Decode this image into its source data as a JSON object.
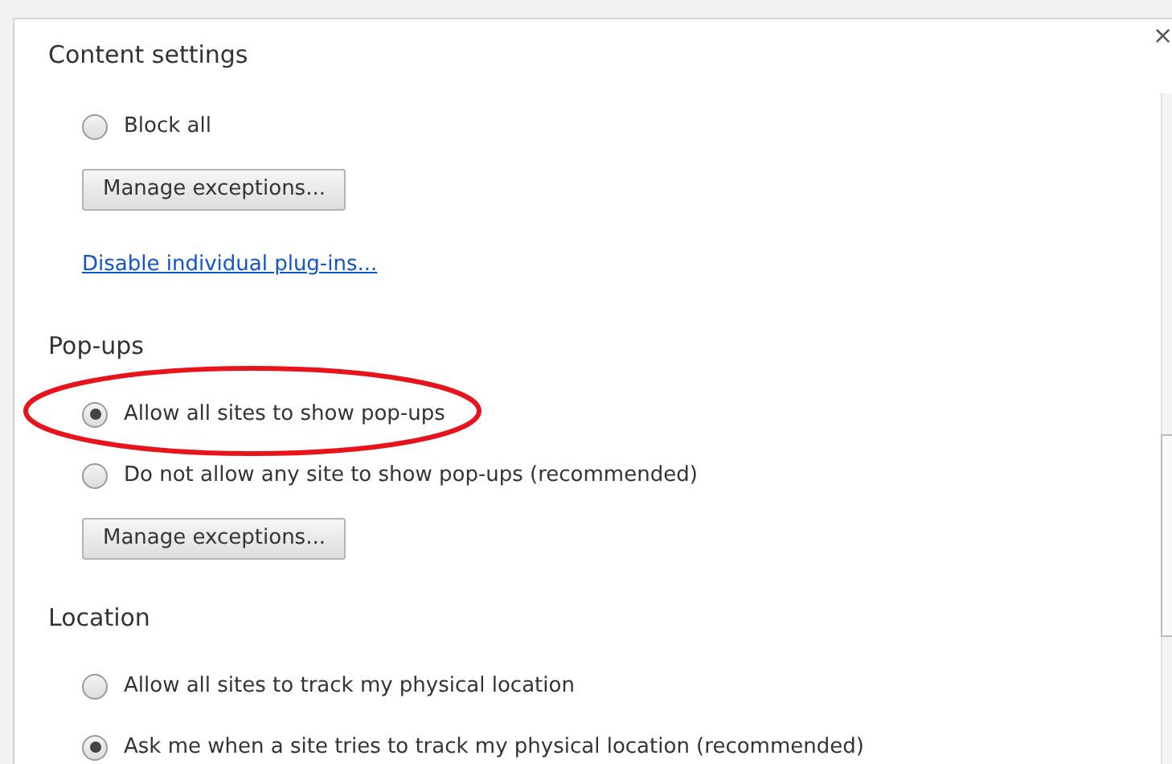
{
  "dialog": {
    "title": "Content settings",
    "close": "×"
  },
  "sections": [
    {
      "items": [
        {
          "kind": "radio",
          "label": "Block all",
          "selected": false
        },
        {
          "kind": "button",
          "label": "Manage exceptions..."
        },
        {
          "kind": "link",
          "label": "Disable individual plug-ins..."
        }
      ]
    },
    {
      "heading": "Pop-ups",
      "items": [
        {
          "kind": "radio",
          "label": "Allow all sites to show pop-ups",
          "selected": true
        },
        {
          "kind": "radio",
          "label": "Do not allow any site to show pop-ups (recommended)",
          "selected": false
        },
        {
          "kind": "button",
          "label": "Manage exceptions..."
        }
      ]
    },
    {
      "heading": "Location",
      "items": [
        {
          "kind": "radio",
          "label": "Allow all sites to track my physical location",
          "selected": false
        },
        {
          "kind": "radio",
          "label": "Ask me when a site tries to track my physical location (recommended)",
          "selected": true
        }
      ]
    }
  ]
}
